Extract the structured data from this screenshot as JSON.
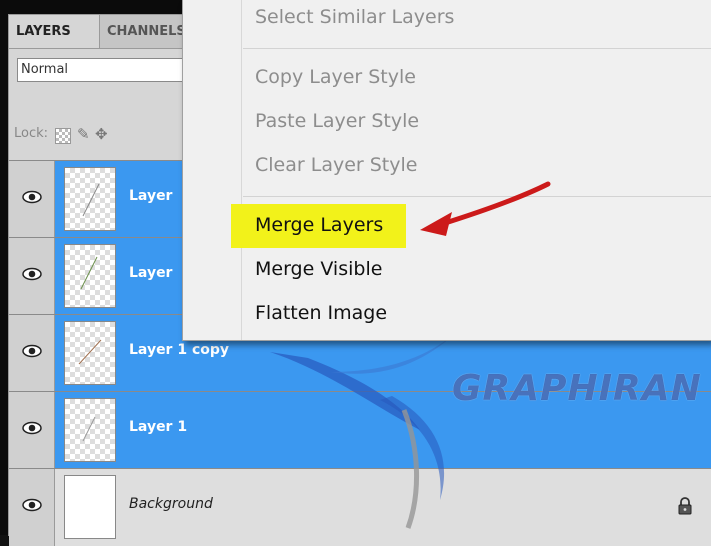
{
  "panel": {
    "tabs": [
      "LAYERS",
      "CHANNELS"
    ],
    "blend_mode": "Normal",
    "lock_label": "Lock:",
    "lock_icons": [
      "lock-transparent-pixels-icon",
      "lock-image-pixels-icon",
      "lock-position-icon"
    ]
  },
  "layers": [
    {
      "name": "Layer",
      "selected": true,
      "visible": true
    },
    {
      "name": "Layer",
      "selected": true,
      "visible": true
    },
    {
      "name": "Layer 1 copy",
      "selected": true,
      "visible": true
    },
    {
      "name": "Layer 1",
      "selected": true,
      "visible": true
    },
    {
      "name": "Background",
      "selected": false,
      "visible": true,
      "locked": true
    }
  ],
  "context_menu": {
    "items": [
      {
        "label": "Select Similar Layers",
        "enabled": false
      },
      {
        "label": "Copy Layer Style",
        "enabled": false
      },
      {
        "label": "Paste Layer Style",
        "enabled": false
      },
      {
        "label": "Clear Layer Style",
        "enabled": false
      },
      {
        "label": "Merge Layers",
        "enabled": true,
        "highlighted": true
      },
      {
        "label": "Merge Visible",
        "enabled": true
      },
      {
        "label": "Flatten Image",
        "enabled": true
      }
    ]
  },
  "annotation": {
    "highlight_color": "#f2f21a",
    "arrow_color": "#cc1a1a"
  },
  "watermark": {
    "text": "GRAPHIRAN"
  },
  "colors": {
    "selection_blue": "#3b98f0",
    "panel_gray": "#d6d6d6",
    "menu_bg": "#f0f0f0"
  }
}
